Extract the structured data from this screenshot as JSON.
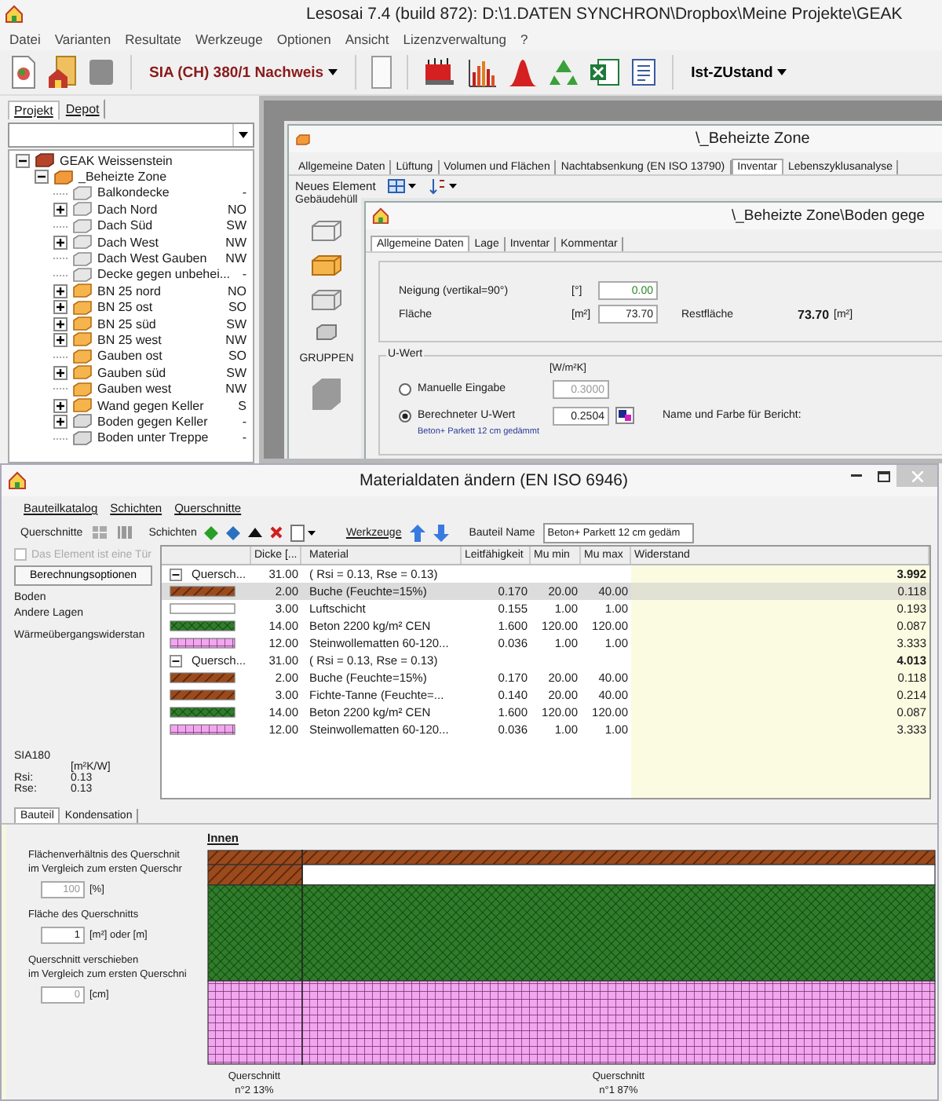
{
  "app": {
    "title": "Lesosai 7.4 (build 872): D:\\1.DATEN SYNCHRON\\Dropbox\\Meine Projekte\\GEAK",
    "menu": [
      "Datei",
      "Varianten",
      "Resultate",
      "Werkzeuge",
      "Optionen",
      "Ansicht",
      "Lizenzverwaltung",
      "?"
    ],
    "norm": "SIA (CH) 380/1 Nachweis",
    "variant": "Ist-ZUstand"
  },
  "sidebar": {
    "tabs": [
      {
        "label": "Projekt",
        "selected": true
      },
      {
        "label": "Depot",
        "selected": false
      }
    ],
    "tree": [
      {
        "label": "GEAK Weissenstein",
        "kind": "building",
        "expander": true,
        "expanded": true,
        "children": [
          {
            "label": "_Beheizte Zone",
            "kind": "zone",
            "expander": true,
            "expanded": true,
            "children": [
              {
                "label": "Balkondecke",
                "orientation": "-",
                "kind": "roof",
                "expander": false
              },
              {
                "label": "Dach Nord",
                "orientation": "NO",
                "kind": "roof",
                "expander": true,
                "expanded": false
              },
              {
                "label": "Dach Süd",
                "orientation": "SW",
                "kind": "roof",
                "expander": false
              },
              {
                "label": "Dach West",
                "orientation": "NW",
                "kind": "roof",
                "expander": true,
                "expanded": false
              },
              {
                "label": "Dach West Gauben",
                "orientation": "NW",
                "kind": "roof",
                "expander": false
              },
              {
                "label": "Decke gegen unbehei...",
                "orientation": "-",
                "kind": "roof",
                "expander": false
              },
              {
                "label": "BN 25 nord",
                "orientation": "NO",
                "kind": "wall",
                "expander": true,
                "expanded": false
              },
              {
                "label": "BN 25 ost",
                "orientation": "SO",
                "kind": "wall",
                "expander": true,
                "expanded": false
              },
              {
                "label": "BN 25 süd",
                "orientation": "SW",
                "kind": "wall",
                "expander": true,
                "expanded": false
              },
              {
                "label": "BN 25 west",
                "orientation": "NW",
                "kind": "wall",
                "expander": true,
                "expanded": false
              },
              {
                "label": "Gauben ost",
                "orientation": "SO",
                "kind": "wall",
                "expander": false
              },
              {
                "label": "Gauben süd",
                "orientation": "SW",
                "kind": "wall",
                "expander": true,
                "expanded": false
              },
              {
                "label": "Gauben west",
                "orientation": "NW",
                "kind": "wall",
                "expander": false
              },
              {
                "label": "Wand gegen Keller",
                "orientation": "S",
                "kind": "wall",
                "expander": true,
                "expanded": false
              },
              {
                "label": "Boden gegen Keller",
                "orientation": "-",
                "kind": "floor",
                "expander": true,
                "expanded": false
              },
              {
                "label": "Boden unter Treppe",
                "orientation": "-",
                "kind": "floor",
                "expander": false
              }
            ]
          }
        ]
      }
    ]
  },
  "zone_window": {
    "title": "\\_Beheizte Zone",
    "tabs": [
      {
        "label": "Allgemeine Daten",
        "selected": false
      },
      {
        "label": "Lüftung",
        "selected": false
      },
      {
        "label": "Volumen und Flächen",
        "selected": false
      },
      {
        "label": "Nachtabsenkung (EN ISO 13790)",
        "selected": false
      },
      {
        "label": "Inventar",
        "selected": true
      },
      {
        "label": "Lebenszyklusanalyse",
        "selected": false
      }
    ],
    "toolbar_label": "Neues Element",
    "section": "Gebäudehüll",
    "group_label": "GRUPPEN"
  },
  "element_window": {
    "title": "\\_Beheizte Zone\\Boden gege",
    "tabs": [
      {
        "label": "Allgemeine Daten",
        "selected": true
      },
      {
        "label": "Lage",
        "selected": false
      },
      {
        "label": "Inventar",
        "selected": false
      },
      {
        "label": "Kommentar",
        "selected": false
      }
    ],
    "fields": [
      {
        "label": "Neigung  (vertikal=90°)",
        "unit": "[°]",
        "value": "0.00"
      },
      {
        "label": "Fläche",
        "unit": "[m²]",
        "value": "73.70"
      }
    ],
    "rest": {
      "label": "Restfläche",
      "value": "73.70",
      "unit": "[m²]"
    },
    "u_value": {
      "legend": "U-Wert",
      "unit": "[W/m²K]",
      "options": [
        {
          "label": "Manuelle Eingabe",
          "value": "0.3000",
          "selected": false
        },
        {
          "label": "Berechneter U-Wert",
          "value": "0.2504",
          "selected": true
        }
      ],
      "note": "Beton+ Parkett 12 cm gedämmt",
      "report_label": "Name und Farbe für Bericht:"
    }
  },
  "material_window": {
    "title": "Materialdaten ändern (EN ISO 6946)",
    "menu": [
      "Bauteilkatalog",
      "Schichten",
      "Querschnitte"
    ],
    "toolbar": {
      "cross_sections": "Querschnitte",
      "layers": "Schichten",
      "tools": "Werkzeuge",
      "name_label": "Bauteil Name",
      "name_value": "Beton+ Parkett 12 cm gedäm"
    },
    "door_checkbox": {
      "label": "Das Element ist eine Tür",
      "checked": false,
      "disabled": true
    },
    "options_button": "Berechnungsoptionen",
    "info": [
      "Boden",
      "Andere Lagen",
      "Wärmeübergangswiderstan"
    ],
    "sia": {
      "title": "SIA180",
      "unit": "[m²K/W]",
      "rows": [
        {
          "label": "Rsi:",
          "value": "0.13"
        },
        {
          "label": "Rse:",
          "value": "0.13"
        }
      ]
    },
    "table": {
      "columns": [
        "Dicke [...",
        "Material",
        "Leitfähigkeit",
        "Mu min",
        "Mu max",
        "Widerstand"
      ],
      "rows": [
        {
          "kind": "group",
          "name": "Quersch...",
          "thickness": "31.00",
          "material": "( Rsi = 0.13, Rse = 0.13)",
          "resistance": "3.992",
          "selected": false
        },
        {
          "kind": "wood",
          "thickness": "2.00",
          "material": "Buche (Feuchte=15%)",
          "conductivity": "0.170",
          "mu_min": "20.00",
          "mu_max": "40.00",
          "resistance": "0.118",
          "selected": true
        },
        {
          "kind": "air",
          "thickness": "3.00",
          "material": "Luftschicht",
          "conductivity": "0.155",
          "mu_min": "1.00",
          "mu_max": "1.00",
          "resistance": "0.193",
          "selected": false
        },
        {
          "kind": "concrete",
          "thickness": "14.00",
          "material": "Beton 2200 kg/m² CEN",
          "conductivity": "1.600",
          "mu_min": "120.00",
          "mu_max": "120.00",
          "resistance": "0.087",
          "selected": false
        },
        {
          "kind": "wool",
          "thickness": "12.00",
          "material": "Steinwollematten 60-120...",
          "conductivity": "0.036",
          "mu_min": "1.00",
          "mu_max": "1.00",
          "resistance": "3.333",
          "selected": false
        },
        {
          "kind": "group",
          "name": "Quersch...",
          "thickness": "31.00",
          "material": "( Rsi = 0.13, Rse = 0.13)",
          "resistance": "4.013",
          "selected": false
        },
        {
          "kind": "wood",
          "thickness": "2.00",
          "material": "Buche (Feuchte=15%)",
          "conductivity": "0.170",
          "mu_min": "20.00",
          "mu_max": "40.00",
          "resistance": "0.118",
          "selected": false
        },
        {
          "kind": "wood",
          "thickness": "3.00",
          "material": "Fichte-Tanne (Feuchte=...",
          "conductivity": "0.140",
          "mu_min": "20.00",
          "mu_max": "40.00",
          "resistance": "0.214",
          "selected": false
        },
        {
          "kind": "concrete",
          "thickness": "14.00",
          "material": "Beton 2200 kg/m² CEN",
          "conductivity": "1.600",
          "mu_min": "120.00",
          "mu_max": "120.00",
          "resistance": "0.087",
          "selected": false
        },
        {
          "kind": "wool",
          "thickness": "12.00",
          "material": "Steinwollematten 60-120...",
          "conductivity": "0.036",
          "mu_min": "1.00",
          "mu_max": "1.00",
          "resistance": "3.333",
          "selected": false
        }
      ]
    },
    "tabs": [
      {
        "label": "Bauteil",
        "selected": true
      },
      {
        "label": "Kondensation",
        "selected": false
      }
    ],
    "section": {
      "heading": "Innen",
      "fields": [
        {
          "lines": [
            "Flächenverhältnis des Querschnit",
            "im Vergleich zum ersten Querschr"
          ],
          "value": "100",
          "unit": "[%]",
          "disabled": true
        },
        {
          "lines": [
            "Fläche des Querschnitts"
          ],
          "value": "1",
          "unit": "[m²] oder [m]",
          "disabled": false
        },
        {
          "lines": [
            "Querschnitt verschieben",
            "im Vergleich zum ersten Querschni"
          ],
          "value": "0",
          "unit": "[cm]",
          "disabled": true
        }
      ],
      "captions": [
        [
          "Querschnitt",
          "n°2 13%"
        ],
        [
          "Querschnitt",
          "n°1 87%"
        ]
      ]
    }
  }
}
